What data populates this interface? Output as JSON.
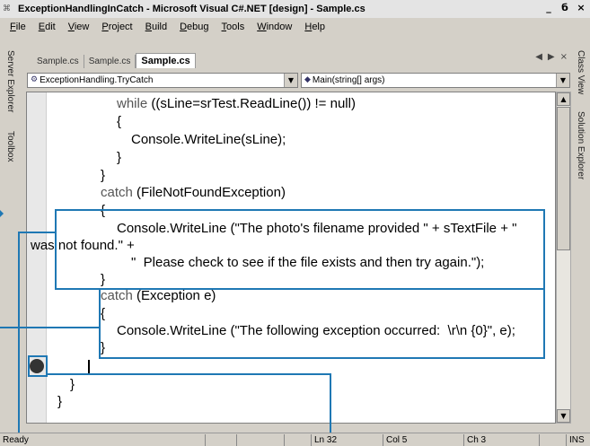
{
  "window": {
    "title": "ExceptionHandlingInCatch - Microsoft Visual C#.NET [design] - Sample.cs",
    "app_icon": "vs-app-icon",
    "controls": [
      "_",
      "б",
      "×"
    ]
  },
  "menu": [
    {
      "u": "F",
      "rest": "ile"
    },
    {
      "u": "E",
      "rest": "dit"
    },
    {
      "u": "V",
      "rest": "iew"
    },
    {
      "u": "P",
      "rest": "roject"
    },
    {
      "u": "B",
      "rest": "uild"
    },
    {
      "u": "D",
      "rest": "ebug"
    },
    {
      "u": "T",
      "rest": "ools"
    },
    {
      "u": "W",
      "rest": "indow"
    },
    {
      "u": "H",
      "rest": "elp"
    }
  ],
  "left_panels": [
    "Server Explorer",
    "Toolbox"
  ],
  "right_panels": [
    "Class View",
    "Solution Explorer"
  ],
  "doc_tabs": [
    {
      "label": "Sample.cs",
      "active": false
    },
    {
      "label": "Sample.cs",
      "active": false
    },
    {
      "label": "Sample.cs",
      "active": true
    }
  ],
  "tab_nav": {
    "prev": "◀",
    "next": "▶",
    "close": "×"
  },
  "class_combo": {
    "value": "ExceptionHandling.TryCatch",
    "icon": "class-icon"
  },
  "member_combo": {
    "value": "Main(string[] args)",
    "icon": "method-icon"
  },
  "code_lines": [
    {
      "kw": "while",
      "rest": " ((sLine=srTest.ReadLine()) != null)"
    },
    {
      "kw": "",
      "rest": "{"
    },
    {
      "kw": "",
      "rest": "Console.WriteLine(sLine);"
    },
    {
      "kw": "",
      "rest": "}"
    },
    {
      "kw": "",
      "rest": "}"
    },
    {
      "kw": "catch",
      "rest": " (FileNotFoundException)"
    },
    {
      "kw": "",
      "rest": "{"
    },
    {
      "kw": "",
      "rest": "Console.WriteLine (\"The photo's filename provided \" + sTextFile + \""
    },
    {
      "kw": "",
      "rest": "was not found.\" +"
    },
    {
      "kw": "",
      "rest": "\"  Please check to see if the file exists and then try again.\");"
    },
    {
      "kw": "",
      "rest": "}"
    },
    {
      "kw": "catch",
      "rest": " (Exception e)"
    },
    {
      "kw": "",
      "rest": "{"
    },
    {
      "kw": "",
      "rest": "Console.WriteLine (\"The following exception occurred:  \\r\\n {0}\", e);"
    },
    {
      "kw": "",
      "rest": "}"
    },
    {
      "kw": "",
      "rest": ""
    },
    {
      "kw": "",
      "rest": "}"
    },
    {
      "kw": "",
      "rest": "}"
    }
  ],
  "status": {
    "ready": "Ready",
    "ln": "Ln 32",
    "col": "Col 5",
    "ch": "Ch 3",
    "ins": "INS"
  },
  "colors": {
    "callout": "#1f78b4",
    "breakpoint": "#333333"
  }
}
